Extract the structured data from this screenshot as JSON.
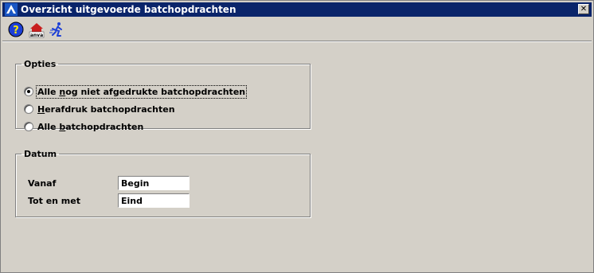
{
  "window": {
    "title": "Overzicht uitgevoerde batchopdrachten",
    "close_symbol": "✕"
  },
  "toolbar": {
    "buttons": [
      {
        "icon": "help-icon",
        "label": "?"
      },
      {
        "icon": "anva-icon",
        "label": "anva"
      },
      {
        "icon": "run-icon",
        "label": ""
      }
    ]
  },
  "opties": {
    "legend": "Opties",
    "options": [
      {
        "pre": "Alle ",
        "accel": "n",
        "post": "og niet afgedrukte batchopdrachten",
        "checked": true
      },
      {
        "pre": "",
        "accel": "H",
        "post": "erafdruk batchopdrachten",
        "checked": false
      },
      {
        "pre": "Alle ",
        "accel": "b",
        "post": "atchopdrachten",
        "checked": false
      }
    ]
  },
  "datum": {
    "legend": "Datum",
    "vanaf_label": "Vanaf",
    "vanaf_value": "Begin",
    "totenmet_label": "Tot en met",
    "totenmet_value": "Eind"
  },
  "colors": {
    "titlebar": "#0a246a",
    "window_bg": "#d4d0c8"
  }
}
